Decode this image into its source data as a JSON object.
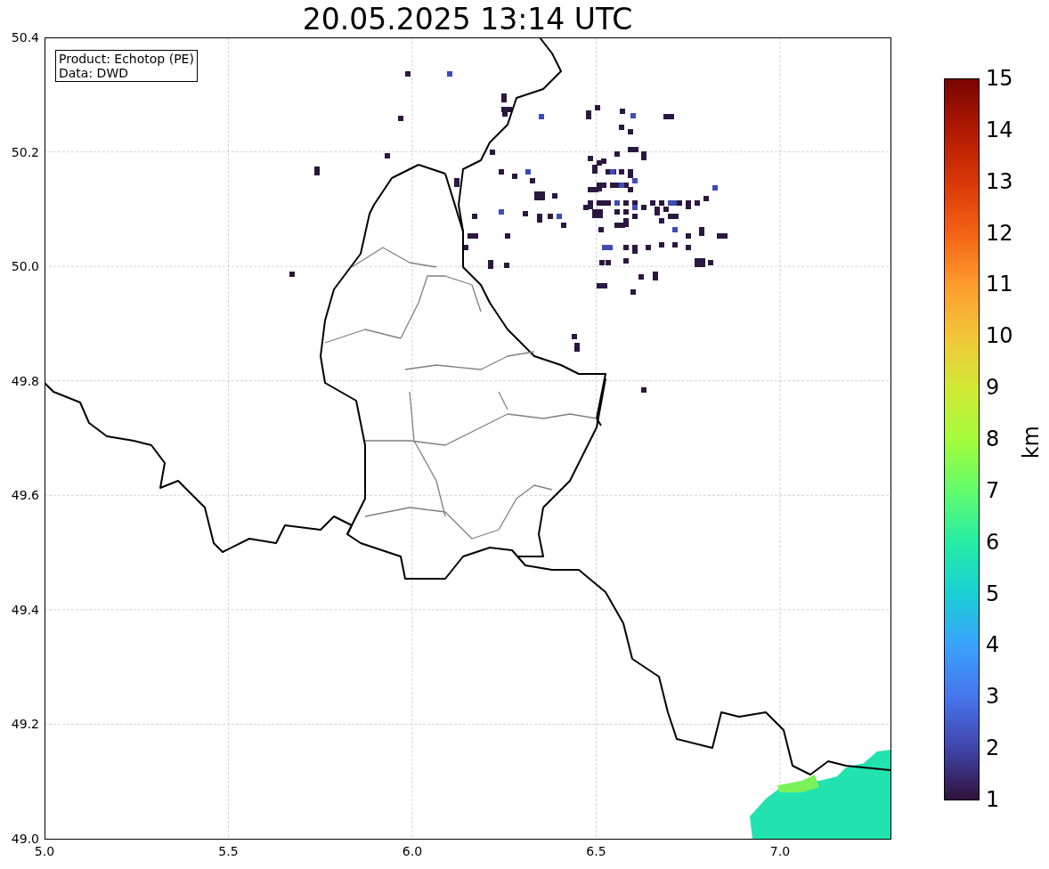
{
  "title": "20.05.2025 13:14 UTC",
  "info_box": [
    "Product: Echotop (PE)",
    "Data: DWD"
  ],
  "x_ticks": [
    "5.0",
    "5.5",
    "6.0",
    "6.5",
    "7.0"
  ],
  "y_ticks": [
    "50.4",
    "50.2",
    "50.0",
    "49.8",
    "49.6",
    "49.4",
    "49.2",
    "49.0"
  ],
  "colorbar": {
    "label": "km",
    "ticks": [
      "15",
      "14",
      "13",
      "12",
      "11",
      "10",
      "9",
      "8",
      "7",
      "6",
      "5",
      "4",
      "3",
      "2",
      "1"
    ]
  }
}
